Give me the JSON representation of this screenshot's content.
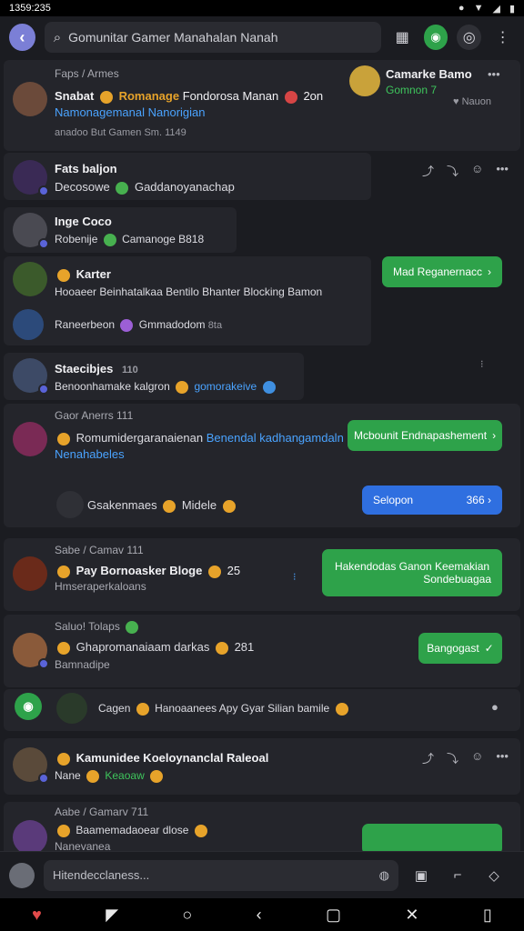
{
  "status": {
    "time": "1359:235",
    "icons": [
      "wifi-icon",
      "signal-icon",
      "battery-icon",
      "alarm-icon"
    ]
  },
  "header": {
    "search_text": "Gomunitar Gamer Manahalan Nanah",
    "icons": [
      "grid-icon",
      "game-icon",
      "target-icon",
      "more-icon"
    ]
  },
  "feed": {
    "c1": {
      "header": "Faps / Armes",
      "name": "Snabat",
      "line1_a": "Romanage",
      "line1_b": "Fondorosa Manan",
      "line1_c": "2on",
      "line2": "Namonagemanal Nanorigian",
      "meta": "anadoo  But Gamen  Sm. 1149",
      "side_name": "Camarke Bamo",
      "side_sub": "Gomnon 7",
      "side_meta": "Nauon"
    },
    "c2": {
      "name": "Fats baljon",
      "line": "Decosowe",
      "line_b": "Gaddanoyanachap"
    },
    "c3": {
      "name": "Inge Coco",
      "line": "Robenije",
      "line_b": "Camanoge",
      "line_c": "B818"
    },
    "c4": {
      "name": "Karter",
      "line": "Hooaeer Beinhatalkaa  Bentilo  Bhanter Blocking Bamon",
      "line2": "Raneerbeon",
      "line2_b": "Gmmadodom",
      "line2_c": "8ta",
      "pill": "Mad Reganernacc"
    },
    "c5": {
      "name": "Staecibjes",
      "name_meta": "110",
      "line": "Benoonhamake kalgron",
      "line_b": "gomorakeive"
    },
    "c6": {
      "header": "Gaor Anerrs 111",
      "line": "Romumidergaranaienan",
      "line_b": "Benendal kadhangamdaln",
      "line_c": "Nenahabeles",
      "pill": "Mcbounit Endnapashement",
      "line2": "Gsakenmaes",
      "line2_b": "Midele",
      "blue_pill": "Selopon",
      "blue_pill_val": "366"
    },
    "c7": {
      "header": "Sabe / Camav 111",
      "name": "Pay Bornoasker Bloge",
      "name_b": "25",
      "sub": "Hmseraperkaloans",
      "pill_1": "Hakendodas Ganon Keemakian",
      "pill_2": "Sondebuagaa"
    },
    "c8": {
      "header": "Saluo! Tolaps",
      "line": "Ghapromanaiaam darkas",
      "line_b": "281",
      "sub": "Bamnadipe",
      "pill": "Bangogast"
    },
    "c9": {
      "line": "Cagen",
      "line_b": "Hanoaanees Apy Gyar Silian bamile"
    },
    "c10": {
      "name": "Kamunidee Koeloynanclal Raleoal",
      "line": "Nane",
      "line_b": "Keaoaw"
    },
    "c11": {
      "header": "Aabe / Gamarv 711",
      "line": "Baamemadaoear dlose",
      "sub": "Nanevanea"
    }
  },
  "composer": {
    "placeholder": "Hitendecclaness...",
    "icons": [
      "image-icon",
      "sticker-icon",
      "send-icon"
    ]
  },
  "navbar": {
    "icons": [
      "logo-icon",
      "back-triangle-icon",
      "home-icon",
      "chevron-back-icon",
      "square-icon",
      "crop-icon",
      "trash-icon"
    ]
  }
}
